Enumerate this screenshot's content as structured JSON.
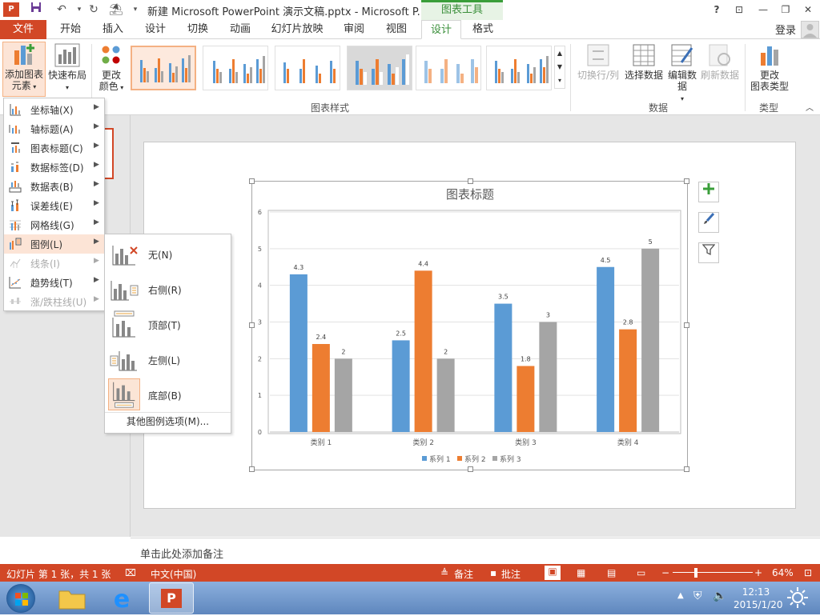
{
  "app": {
    "title": "新建 Microsoft PowerPoint 演示文稿.pptx - Microsoft P...",
    "context_tab": "图表工具",
    "login": "登录"
  },
  "tabs": [
    {
      "label": "文件"
    },
    {
      "label": "开始"
    },
    {
      "label": "插入"
    },
    {
      "label": "设计"
    },
    {
      "label": "切换"
    },
    {
      "label": "动画"
    },
    {
      "label": "幻灯片放映"
    },
    {
      "label": "审阅"
    },
    {
      "label": "视图"
    },
    {
      "label": "设计"
    },
    {
      "label": "格式"
    }
  ],
  "ribbon": {
    "add_element_line1": "添加图表",
    "add_element_line2": "元素",
    "quick_layout": "快速布局",
    "change_colors_line1": "更改",
    "change_colors_line2": "颜色",
    "chart_styles_label": "图表样式",
    "switch_row_col": "切换行/列",
    "select_data": "选择数据",
    "edit_data_line1": "编辑数",
    "edit_data_line2": "据",
    "refresh_data": "刷新数据",
    "data_label": "数据",
    "change_type_line1": "更改",
    "change_type_line2": "图表类型",
    "type_label": "类型"
  },
  "element_menu": [
    {
      "label": "坐标轴(X)",
      "disabled": false
    },
    {
      "label": "轴标题(A)",
      "disabled": false
    },
    {
      "label": "图表标题(C)",
      "disabled": false
    },
    {
      "label": "数据标签(D)",
      "disabled": false
    },
    {
      "label": "数据表(B)",
      "disabled": false
    },
    {
      "label": "误差线(E)",
      "disabled": false
    },
    {
      "label": "网格线(G)",
      "disabled": false
    },
    {
      "label": "图例(L)",
      "disabled": false
    },
    {
      "label": "线条(I)",
      "disabled": true
    },
    {
      "label": "趋势线(T)",
      "disabled": false
    },
    {
      "label": "涨/跌柱线(U)",
      "disabled": true
    }
  ],
  "legend_menu": {
    "items": [
      {
        "label": "无(N)"
      },
      {
        "label": "右侧(R)"
      },
      {
        "label": "顶部(T)"
      },
      {
        "label": "左侧(L)"
      },
      {
        "label": "底部(B)"
      }
    ],
    "more": "其他图例选项(M)..."
  },
  "notes_placeholder": "单击此处添加备注",
  "status": {
    "slide_info": "幻灯片 第 1 张，共 1 张",
    "language": "中文(中国)",
    "notes": "备注",
    "comments": "批注",
    "zoom": "64%"
  },
  "clock": {
    "time": "12:13",
    "date": "2015/1/20"
  },
  "colors": {
    "accent": "#d24726",
    "series1": "#5b9bd5",
    "series2": "#ed7d31",
    "series3": "#a5a5a5"
  },
  "chart_data": {
    "type": "bar",
    "title": "图表标题",
    "categories": [
      "类别 1",
      "类别 2",
      "类别 3",
      "类别 4"
    ],
    "series": [
      {
        "name": "系列 1",
        "values": [
          4.3,
          2.5,
          3.5,
          4.5
        ]
      },
      {
        "name": "系列 2",
        "values": [
          2.4,
          4.4,
          1.8,
          2.8
        ]
      },
      {
        "name": "系列 3",
        "values": [
          2,
          2,
          3,
          5
        ]
      }
    ],
    "ylim": [
      0,
      6
    ],
    "yticks": [
      0,
      1,
      2,
      3,
      4,
      5,
      6
    ],
    "grid": true,
    "legend": "bottom"
  }
}
